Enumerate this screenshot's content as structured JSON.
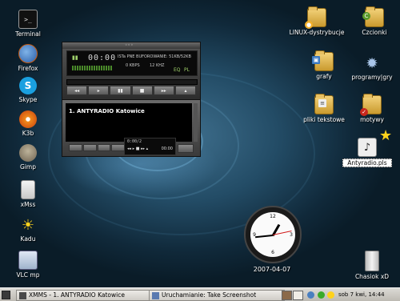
{
  "desktop": {
    "left_icons": [
      {
        "label": "Terminal"
      },
      {
        "label": "Firefox"
      },
      {
        "label": "Skype"
      },
      {
        "label": "K3b"
      },
      {
        "label": "Gimp"
      },
      {
        "label": "xMss"
      },
      {
        "label": "Kadu"
      },
      {
        "label": "VLC mp"
      }
    ],
    "right_icons": [
      {
        "label": "LINUX-dystrybucje"
      },
      {
        "label": "Czcionki"
      },
      {
        "label": "grafy"
      },
      {
        "label": "programy|gry"
      },
      {
        "label": "pliki tekstowe"
      },
      {
        "label": "motywy"
      },
      {
        "label": "Antyradio.pls"
      },
      {
        "label": "Chasiok xD"
      }
    ]
  },
  "xmms": {
    "time": "00:00",
    "status": "ISTa PNE BUFOROWANIE: 51KB/52KB",
    "bitrate": "0 KBPS",
    "samplerate": "12 KHZ",
    "eq_label": "EQ",
    "pl_label": "PL",
    "playlist_entry": "1. ANTYRADIO Katowice",
    "mini_time": "0:00/2",
    "mini_controls": "◂◂ ▸ ■ ▸▸ ▴",
    "mini_elapsed": "00:00"
  },
  "clock": {
    "date": "2007-04-07"
  },
  "taskbar": {
    "task1": "XMMS - 1. ANTYRADIO Katowice",
    "task2": "Uruchamianie: Take Screenshot",
    "datetime": "sob  7 kwi, 14:44"
  },
  "colors": {
    "desktop_bg": "#234c66",
    "taskbar_bg": "#d4d2cc",
    "accent_clock_hand": "#d01818"
  }
}
